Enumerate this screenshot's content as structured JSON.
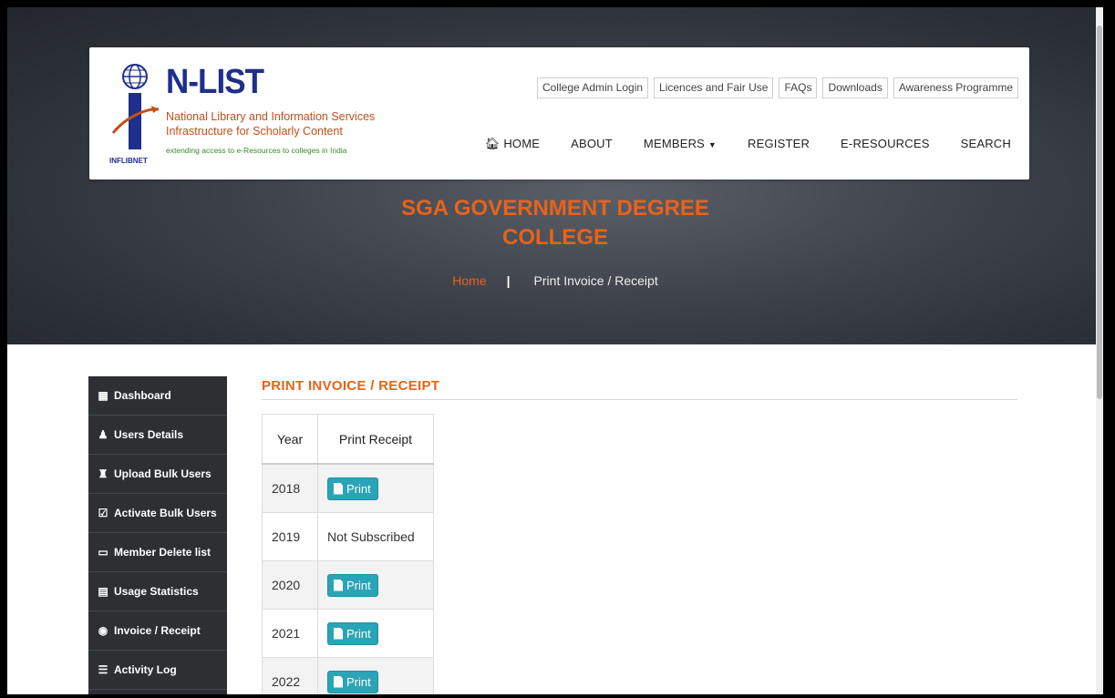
{
  "brand": {
    "title": "N-LIST",
    "line1": "National Library and Information Services",
    "line2": "Infrastructure for Scholarly Content",
    "tagline": "extending access to e-Resources to colleges in India",
    "emblem_label": "INFLIBNET"
  },
  "topnav": [
    "College Admin Login",
    "Licences and Fair Use",
    "FAQs",
    "Downloads",
    "Awareness Programme"
  ],
  "mainnav": {
    "home": "HOME",
    "about": "ABOUT",
    "members": "MEMBERS",
    "register": "REGISTER",
    "eresources": "E-RESOURCES",
    "search": "SEARCH"
  },
  "hero": {
    "college_line1": "SGA GOVERNMENT DEGREE",
    "college_line2": "COLLEGE",
    "crumb_home": "Home",
    "crumb_sep": "|",
    "crumb_current": "Print Invoice / Receipt"
  },
  "sidebar": [
    {
      "label": "Dashboard",
      "icon": "dashboard-icon"
    },
    {
      "label": "Users Details",
      "icon": "users-icon"
    },
    {
      "label": "Upload Bulk Users",
      "icon": "users-group-icon"
    },
    {
      "label": "Activate Bulk Users",
      "icon": "checkbox-icon"
    },
    {
      "label": "Member Delete list",
      "icon": "trash-icon"
    },
    {
      "label": "Usage Statistics",
      "icon": "bar-chart-icon"
    },
    {
      "label": "Invoice / Receipt",
      "icon": "lock-icon"
    },
    {
      "label": "Activity Log",
      "icon": "list-icon"
    }
  ],
  "section": {
    "title": "PRINT INVOICE / RECEIPT"
  },
  "table": {
    "headers": [
      "Year",
      "Print Receipt"
    ],
    "rows": [
      {
        "year": "2018",
        "action": "Print"
      },
      {
        "year": "2019",
        "action": "Not Subscribed"
      },
      {
        "year": "2020",
        "action": "Print"
      },
      {
        "year": "2021",
        "action": "Print"
      },
      {
        "year": "2022",
        "action": "Print"
      }
    ]
  },
  "colors": {
    "accent": "#e8631a",
    "button": "#2aa4b7",
    "sidebar": "#2d2f33"
  }
}
